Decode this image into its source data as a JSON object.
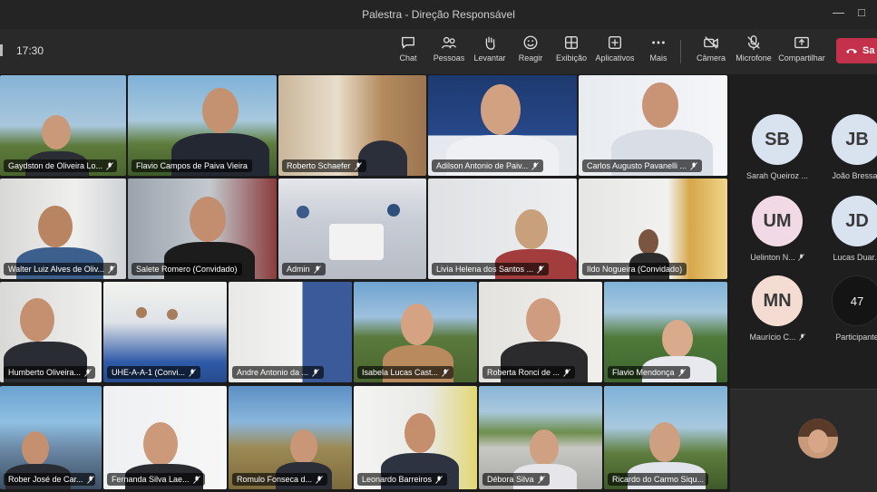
{
  "window": {
    "title": "Palestra - Direção Responsável"
  },
  "toolbar": {
    "timer": "17:30",
    "buttons": [
      {
        "label": "Chat",
        "icon": "chat-icon"
      },
      {
        "label": "Pessoas",
        "icon": "people-icon"
      },
      {
        "label": "Levantar",
        "icon": "raise-hand-icon"
      },
      {
        "label": "Reagir",
        "icon": "smiley-icon"
      },
      {
        "label": "Exibição",
        "icon": "view-grid-icon"
      },
      {
        "label": "Aplicativos",
        "icon": "apps-plus-icon"
      },
      {
        "label": "Mais",
        "icon": "more-icon"
      },
      {
        "label": "Câmera",
        "icon": "camera-off-icon"
      },
      {
        "label": "Microfone",
        "icon": "mic-off-icon"
      },
      {
        "label": "Compartilhar",
        "icon": "share-icon"
      }
    ],
    "leave_label": "Sa"
  },
  "participants": [
    {
      "name": "Gaydston de Oliveira Lo..."
    },
    {
      "name": "Flavio Campos de Paiva Vieira"
    },
    {
      "name": "Roberto Schaefer"
    },
    {
      "name": "Adilson Antonio de Paiv..."
    },
    {
      "name": "Carlos Augusto Pavanelli ..."
    },
    {
      "name": "Walter Luiz Alves de Oliv..."
    },
    {
      "name": "Salete Romero (Convidado)"
    },
    {
      "name": "Admin"
    },
    {
      "name": "Livia Helena dos Santos ..."
    },
    {
      "name": "Ildo Nogueira (Convidado)"
    },
    {
      "name": "Humberto Oliveira..."
    },
    {
      "name": "UHE-A-A-1 (Convi..."
    },
    {
      "name": "Andre Antonio da ..."
    },
    {
      "name": "Isabela Lucas Cast..."
    },
    {
      "name": "Roberta Ronci de ..."
    },
    {
      "name": "Flavio Mendonça"
    },
    {
      "name": "Rober José de Car..."
    },
    {
      "name": "Fernanda Silva Lae..."
    },
    {
      "name": "Romulo Fonseca d..."
    },
    {
      "name": "Leonardo Barreiros"
    },
    {
      "name": "Débora Silva"
    },
    {
      "name": "Ricardo do Carmo Siqu..."
    }
  ],
  "overflow": [
    {
      "initials": "SB",
      "name": "Sarah Queiroz ...",
      "color": "#d9e3ef"
    },
    {
      "initials": "JB",
      "name": "João Bressan",
      "color": "#d9e3ef"
    },
    {
      "initials": "UM",
      "name": "Uelinton N...",
      "color": "#f1d9e6"
    },
    {
      "initials": "JD",
      "name": "Lucas Duar...",
      "color": "#d9e3ef"
    },
    {
      "initials": "MN",
      "name": "Maurício C...",
      "color": "#f4dcd3"
    }
  ],
  "participants_count": {
    "number": "47",
    "label": "Participante"
  },
  "colors": {
    "accent": "#7b83eb",
    "leave": "#c4314b"
  }
}
